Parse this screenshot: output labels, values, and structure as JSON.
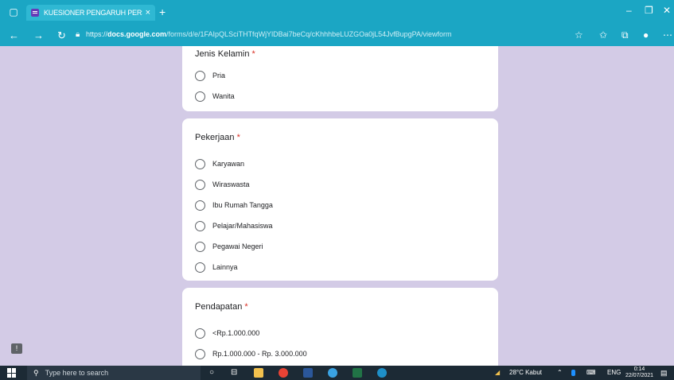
{
  "browser": {
    "tab_title": "KUESIONER PENGARUH PERSEP",
    "tab_close": "×",
    "new_tab": "+",
    "url_scheme": "https://",
    "url_host": "docs.google.com",
    "url_path": "/forms/d/e/1FAIpQLSciTHTfqWjYlDBai7beCq/cKhhhbeLUZGOa0jL54JvfBupgPA/viewform"
  },
  "form": {
    "questions": [
      {
        "title": "Jenis Kelamin",
        "required_mark": "*",
        "options": [
          "Pria",
          "Wanita"
        ]
      },
      {
        "title": "Pekerjaan",
        "required_mark": "*",
        "options": [
          "Karyawan",
          "Wiraswasta",
          "Ibu Rumah Tangga",
          "Pelajar/Mahasiswa",
          "Pegawai Negeri",
          "Lainnya"
        ]
      },
      {
        "title": "Pendapatan",
        "required_mark": "*",
        "options": [
          "<Rp.1.000.000",
          "Rp.1.000.000 - Rp. 3.000.000"
        ]
      }
    ]
  },
  "taskbar": {
    "search_placeholder": "Type here to search",
    "weather": "28°C  Kabut",
    "language": "ENG",
    "time": "0:14",
    "date": "22/07/2021"
  },
  "colors": {
    "browser_accent": "#1ba6c4",
    "page_background": "#d3cbe6",
    "required": "#d93025"
  }
}
